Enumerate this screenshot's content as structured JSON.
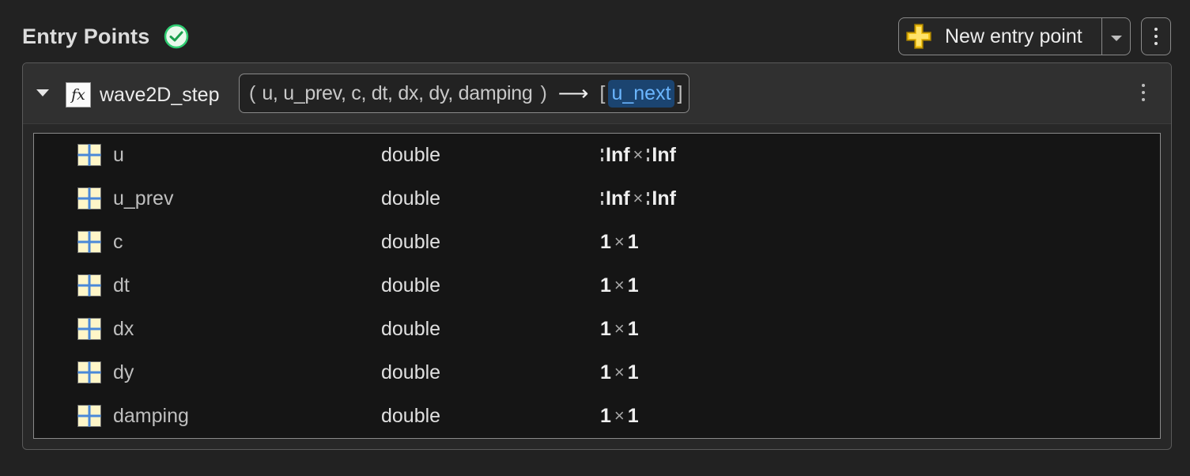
{
  "header": {
    "title": "Entry Points",
    "status_icon": "check-circle-icon",
    "status_color": "#2ecc71",
    "new_entry_label": "New entry point",
    "accent_plus_color": "#f5c518"
  },
  "entry_point": {
    "name": "wave2D_step",
    "icon_label": "fx",
    "signature": {
      "open_paren": "(",
      "inputs": "u, u_prev, c, dt, dx, dy, damping",
      "close_paren": ")",
      "arrow": "⟶",
      "open_bracket": "[",
      "output": "u_next",
      "close_bracket": "]"
    },
    "args": [
      {
        "name": "u",
        "type": "double",
        "rows": "Inf",
        "cols": "Inf",
        "variable": true
      },
      {
        "name": "u_prev",
        "type": "double",
        "rows": "Inf",
        "cols": "Inf",
        "variable": true
      },
      {
        "name": "c",
        "type": "double",
        "rows": "1",
        "cols": "1",
        "variable": false
      },
      {
        "name": "dt",
        "type": "double",
        "rows": "1",
        "cols": "1",
        "variable": false
      },
      {
        "name": "dx",
        "type": "double",
        "rows": "1",
        "cols": "1",
        "variable": false
      },
      {
        "name": "dy",
        "type": "double",
        "rows": "1",
        "cols": "1",
        "variable": false
      },
      {
        "name": "damping",
        "type": "double",
        "rows": "1",
        "cols": "1",
        "variable": false
      }
    ],
    "times_symbol": "×"
  }
}
